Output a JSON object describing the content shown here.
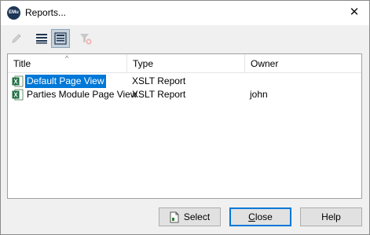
{
  "window": {
    "title": "Reports...",
    "app_icon_text": "EMu"
  },
  "toolbar": {
    "buttons": [
      {
        "icon": "edit-pencil-icon",
        "enabled": false
      },
      {
        "icon": "list-view-icon",
        "active": false
      },
      {
        "icon": "details-view-icon",
        "active": true
      },
      {
        "icon": "clear-filter-icon",
        "enabled": false
      }
    ]
  },
  "table": {
    "columns": [
      "Title",
      "Type",
      "Owner"
    ],
    "sorted_column": "Title",
    "rows": [
      {
        "title": "Default Page View",
        "type": "XSLT Report",
        "owner": "",
        "selected": true
      },
      {
        "title": "Parties Module Page View",
        "type": "XSLT Report",
        "owner": "john",
        "selected": false
      }
    ]
  },
  "buttons": {
    "select": "Select",
    "close": "Close",
    "close_mnemonic": "C",
    "close_rest": "lose",
    "help": "Help"
  }
}
